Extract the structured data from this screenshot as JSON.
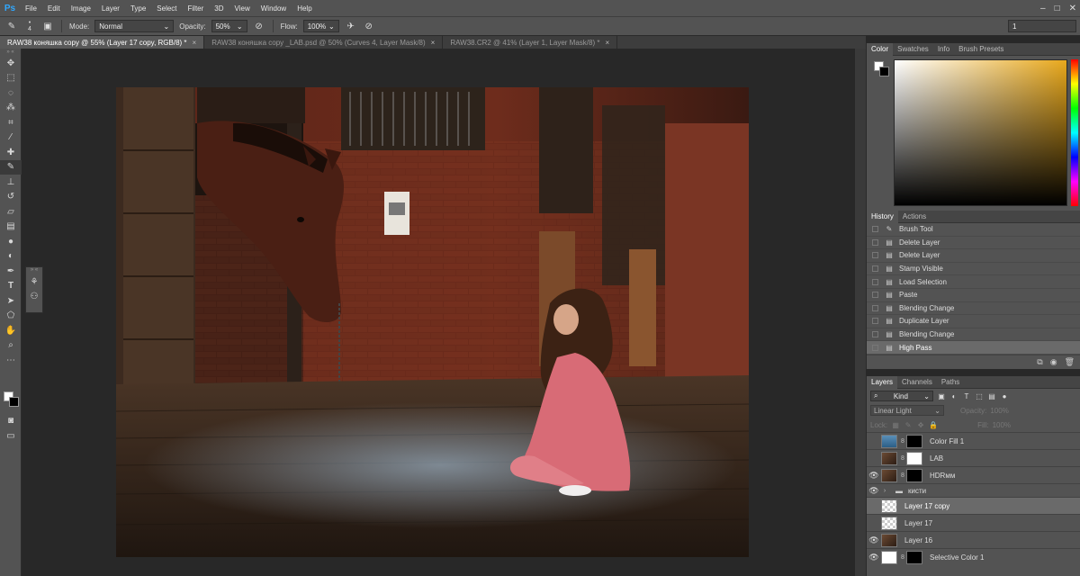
{
  "app": {
    "logo": "Ps"
  },
  "menu": [
    "File",
    "Edit",
    "Image",
    "Layer",
    "Type",
    "Select",
    "Filter",
    "3D",
    "View",
    "Window",
    "Help"
  ],
  "window_controls": [
    "minimize-icon",
    "maximize-icon",
    "close-icon"
  ],
  "options": {
    "brush_size": "4",
    "mode_label": "Mode:",
    "mode_value": "Normal",
    "opacity_label": "Opacity:",
    "opacity_value": "50%",
    "flow_label": "Flow:",
    "flow_value": "100%",
    "right_value": "1"
  },
  "tabs": [
    {
      "label": "RAW38 коняшка copy @ 55% (Layer 17 copy, RGB/8) *",
      "active": true
    },
    {
      "label": "RAW38 коняшка copy _LAB.psd @ 50% (Curves 4, Layer Mask/8)",
      "active": false
    },
    {
      "label": "RAW38.CR2 @ 41% (Layer 1, Layer Mask/8) *",
      "active": false
    }
  ],
  "tab_close": "×",
  "tools": [
    "move-icon",
    "marquee-icon",
    "lasso-icon",
    "quick-select-icon",
    "crop-icon",
    "eyedropper-icon",
    "healing-icon",
    "brush-icon",
    "stamp-icon",
    "history-brush-icon",
    "eraser-icon",
    "gradient-icon",
    "blur-icon",
    "dodge-icon",
    "pen-icon",
    "type-icon",
    "path-select-icon",
    "shape-icon",
    "hand-icon",
    "zoom-icon",
    "more-icon"
  ],
  "color_panel": {
    "tabs": [
      "Color",
      "Swatches",
      "Info",
      "Brush Presets"
    ]
  },
  "history_panel": {
    "tabs": [
      "History",
      "Actions"
    ],
    "items": [
      "Brush Tool",
      "Delete Layer",
      "Delete Layer",
      "Stamp Visible",
      "Load Selection",
      "Paste",
      "Blending Change",
      "Duplicate Layer",
      "Blending Change",
      "High Pass"
    ],
    "selected_index": 9
  },
  "layers_panel": {
    "tabs": [
      "Layers",
      "Channels",
      "Paths"
    ],
    "kind": "Kind",
    "blend_mode": "Linear Light",
    "opacity_label": "Opacity:",
    "opacity_value": "100%",
    "lock_label": "Lock:",
    "fill_label": "Fill:",
    "fill_value": "100%",
    "layers": [
      {
        "name": "Color Fill 1",
        "visible": false,
        "thumb": "thumb-blue",
        "mask": "thumb-black",
        "selected": false
      },
      {
        "name": "LAB",
        "visible": false,
        "thumb": "thumb-photo",
        "mask": "thumb-white",
        "selected": false
      },
      {
        "name": "HDRмм",
        "visible": true,
        "thumb": "thumb-photo",
        "mask": "thumb-black",
        "selected": false
      },
      {
        "name": "кисти",
        "visible": true,
        "folder": true,
        "selected": false
      },
      {
        "name": "Layer 17 copy",
        "visible": false,
        "thumb": "thumb-check",
        "selected": true
      },
      {
        "name": "Layer 17",
        "visible": false,
        "thumb": "thumb-check",
        "selected": false
      },
      {
        "name": "Layer 16",
        "visible": true,
        "thumb": "thumb-photo",
        "selected": false
      },
      {
        "name": "Selective Color 1",
        "visible": true,
        "thumb": "thumb-white",
        "mask": "thumb-black",
        "selected": false
      }
    ]
  }
}
